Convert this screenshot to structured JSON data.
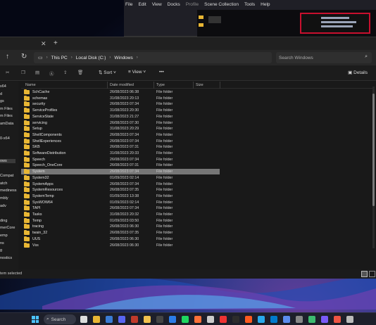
{
  "background_app": {
    "menu": [
      "File",
      "Edit",
      "View",
      "Docks",
      "Profile",
      "Scene Collection",
      "Tools",
      "Help"
    ]
  },
  "explorer": {
    "address": {
      "crumbs": [
        "This PC",
        "Local Disk (C:)",
        "Windows"
      ]
    },
    "search_placeholder": "Search Windows",
    "commands": {
      "sort": "Sort",
      "view": "View",
      "more": "•••",
      "details": "Details"
    },
    "columns": {
      "name": "Name",
      "date": "Date modified",
      "type": "Type",
      "size": "Size"
    },
    "sidebar_items": [
      "x64",
      "d",
      "gs",
      "m Files",
      "m Files",
      "amData",
      "",
      "0-x64",
      "",
      "",
      "ows",
      "",
      "Compat",
      "atch",
      "mediness",
      "mbly",
      "adv",
      "",
      "ding",
      "merCore",
      "emp",
      "ns",
      "g",
      "nostics"
    ],
    "rows": [
      {
        "name": "SchCache",
        "date": "26/08/2023 06:38",
        "type": "File folder"
      },
      {
        "name": "schemas",
        "date": "31/08/2023 20:13",
        "type": "File folder"
      },
      {
        "name": "security",
        "date": "26/08/2023 07:34",
        "type": "File folder"
      },
      {
        "name": "ServiceProfiles",
        "date": "31/08/2023 20:30",
        "type": "File folder"
      },
      {
        "name": "ServiceState",
        "date": "31/08/2023 21:27",
        "type": "File folder"
      },
      {
        "name": "servicing",
        "date": "26/08/2023 07:30",
        "type": "File folder"
      },
      {
        "name": "Setup",
        "date": "31/08/2023 20:29",
        "type": "File folder"
      },
      {
        "name": "ShellComponents",
        "date": "26/08/2023 07:34",
        "type": "File folder"
      },
      {
        "name": "ShellExperiences",
        "date": "26/08/2023 07:34",
        "type": "File folder"
      },
      {
        "name": "SKB",
        "date": "26/08/2023 07:31",
        "type": "File folder"
      },
      {
        "name": "SoftwareDistribution",
        "date": "31/08/2023 20:33",
        "type": "File folder"
      },
      {
        "name": "Speech",
        "date": "26/08/2023 07:34",
        "type": "File folder"
      },
      {
        "name": "Speech_OneCore",
        "date": "26/08/2023 07:31",
        "type": "File folder"
      },
      {
        "name": "System",
        "date": "26/08/2023 07:34",
        "type": "File folder",
        "selected": true
      },
      {
        "name": "System32",
        "date": "01/09/2023 02:14",
        "type": "File folder"
      },
      {
        "name": "SystemApps",
        "date": "26/08/2023 07:34",
        "type": "File folder"
      },
      {
        "name": "SystemResources",
        "date": "26/08/2023 07:35",
        "type": "File folder"
      },
      {
        "name": "SystemTemp",
        "date": "01/09/2023 13:38",
        "type": "File folder"
      },
      {
        "name": "SysWOW64",
        "date": "01/09/2023 02:14",
        "type": "File folder"
      },
      {
        "name": "TAPI",
        "date": "26/08/2023 07:34",
        "type": "File folder"
      },
      {
        "name": "Tasks",
        "date": "31/08/2023 20:32",
        "type": "File folder"
      },
      {
        "name": "Temp",
        "date": "01/09/2023 03:50",
        "type": "File folder"
      },
      {
        "name": "tracing",
        "date": "26/08/2023 06:30",
        "type": "File folder"
      },
      {
        "name": "twain_32",
        "date": "26/08/2023 07:35",
        "type": "File folder"
      },
      {
        "name": "UUS",
        "date": "26/08/2023 06:30",
        "type": "File folder"
      },
      {
        "name": "Vss",
        "date": "26/08/2023 06:30",
        "type": "File folder"
      }
    ],
    "status": "tem selected"
  },
  "taskbar": {
    "search": "Search"
  },
  "colors": {
    "folder": "#e8b634",
    "selection": "#767676",
    "accent": "#4cc2ff",
    "obs_scene_border": "#c8102e"
  }
}
